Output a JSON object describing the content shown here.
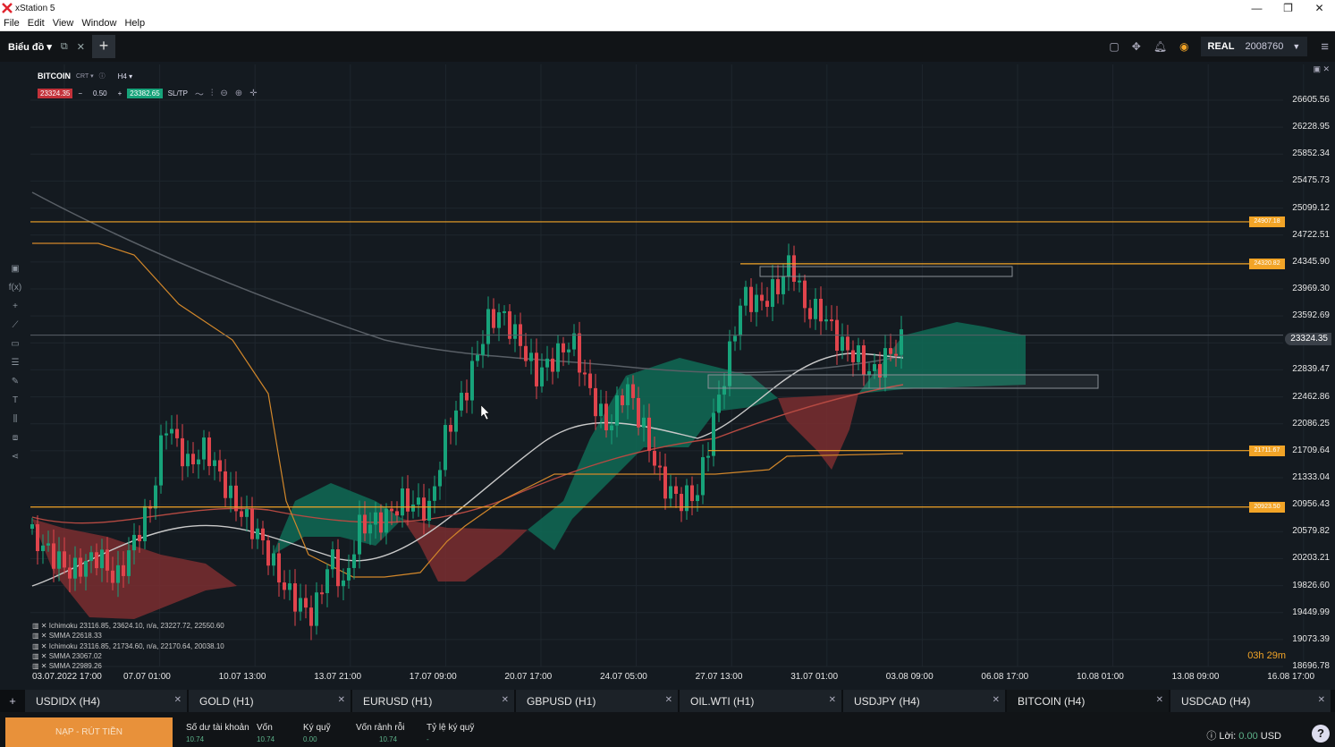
{
  "window": {
    "title": "xStation 5",
    "menu": [
      "File",
      "Edit",
      "View",
      "Window",
      "Help"
    ]
  },
  "toolbar": {
    "charts_tab": "Biểu đồ",
    "account_type": "REAL",
    "account_number": "2008760"
  },
  "chart": {
    "symbol": "BITCOIN",
    "symbol_sub": "CRT",
    "timeframe": "H4",
    "sell_price": "23324.35",
    "volume": "0.50",
    "buy_price": "23382.65",
    "sltp_label": "SL/TP",
    "countdown": "03h 29m",
    "current_price_tag": "23324.35",
    "level_tags": [
      "24907.18",
      "24320.82",
      "21711.67",
      "20923.50"
    ],
    "indicators": [
      "Ichimoku 23116.85, 23624.10, n/a, 23227.72, 22550.60",
      "SMMA 22618.33",
      "Ichimoku 23116.85, 21734.60, n/a, 22170.64, 20038.10",
      "SMMA 23067.02",
      "SMMA 22989.26"
    ],
    "y_ticks": [
      "26605.56",
      "26228.95",
      "25852.34",
      "25475.73",
      "25099.12",
      "24722.51",
      "24345.90",
      "23969.30",
      "23592.69",
      "23216.08",
      "22839.47",
      "22462.86",
      "22086.25",
      "21709.64",
      "21333.04",
      "20956.43",
      "20579.82",
      "20203.21",
      "19826.60",
      "19449.99",
      "19073.39",
      "18696.78"
    ],
    "x_ticks": [
      "03.07.2022 17:00",
      "07.07 01:00",
      "10.07 13:00",
      "13.07 21:00",
      "17.07 09:00",
      "20.07 17:00",
      "24.07 05:00",
      "27.07 13:00",
      "31.07 01:00",
      "03.08 09:00",
      "06.08 17:00",
      "10.08 01:00",
      "13.08 09:00",
      "16.08 17:00"
    ],
    "colors": {
      "up": "#17a37a",
      "down": "#e0444c",
      "level": "#f2a427",
      "background": "#141a20"
    }
  },
  "chart_data": {
    "type": "candlestick",
    "title": "",
    "xlabel": "",
    "ylabel": "",
    "ylim": [
      18696.78,
      26605.56
    ],
    "horizontal_levels": [
      24907.18,
      24320.82,
      21711.67,
      20923.5
    ],
    "current_price": 23324.35,
    "grid": true
  },
  "tabs": [
    {
      "label": "USDIDX (H4)"
    },
    {
      "label": "GOLD (H1)"
    },
    {
      "label": "EURUSD (H1)"
    },
    {
      "label": "GBPUSD (H1)"
    },
    {
      "label": "OIL.WTI (H1)"
    },
    {
      "label": "USDJPY (H4)"
    },
    {
      "label": "BITCOIN (H4)"
    },
    {
      "label": "USDCAD (H4)"
    }
  ],
  "account": {
    "deposit_button": "NẠP - RÚT TIỀN",
    "balance_label": "Số dư tài khoản",
    "balance_value": "10.74",
    "equity_label": "Vốn",
    "equity_value": "10.74",
    "margin_label": "Ký quỹ",
    "margin_value": "0.00",
    "free_margin_label": "Vốn rảnh rỗi",
    "free_margin_value": "10.74",
    "margin_level_label": "Tỷ lệ ký quỹ",
    "margin_level_value": "-",
    "profit_label": "Lời:",
    "profit_value": "0.00",
    "profit_currency": "USD"
  }
}
